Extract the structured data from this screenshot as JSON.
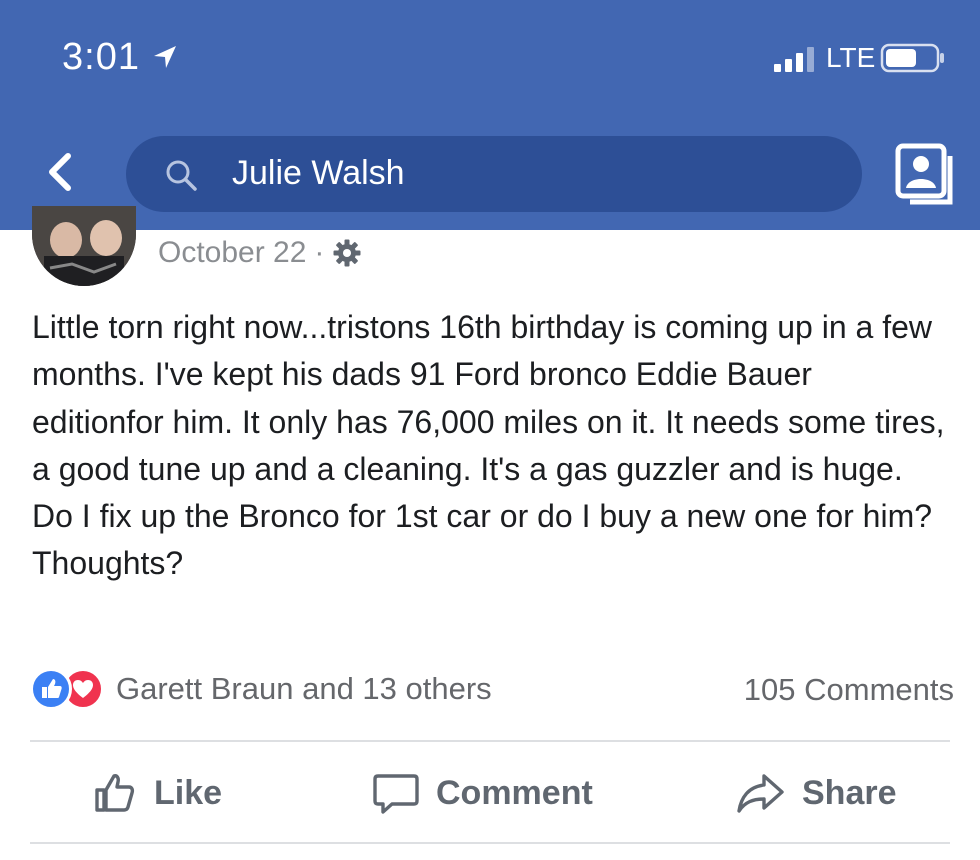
{
  "status_bar": {
    "time": "3:01",
    "network": "LTE",
    "icons": [
      "location-arrow-icon",
      "signal-bars-icon",
      "battery-icon"
    ]
  },
  "nav": {
    "back_icon": "chevron-left-icon",
    "search_icon": "search-icon",
    "search_text": "Julie Walsh",
    "profile_icon": "profile-card-icon"
  },
  "post": {
    "date": "October 22",
    "separator": "·",
    "privacy_icon": "gear-icon",
    "body": "Little torn right now...tristons 16th birthday is coming up in a few months. I've kept his dads 91 Ford bronco Eddie Bauer editionfor him. It only has 76,000 miles on it. It needs some tires, a good tune up and a cleaning. It's a gas guzzler and is huge. Do I fix up the Bronco for 1st car or do I buy a new one for him? Thoughts?",
    "reactions_text": "Garett Braun and 13 others",
    "comments_text": "105 Comments"
  },
  "actions": {
    "like": "Like",
    "comment": "Comment",
    "share": "Share"
  },
  "colors": {
    "header_bg": "#4267b2",
    "search_bg": "#2d4f96",
    "like_reaction": "#3b80f4",
    "love_reaction": "#f0334f",
    "muted_text": "#65676b"
  }
}
